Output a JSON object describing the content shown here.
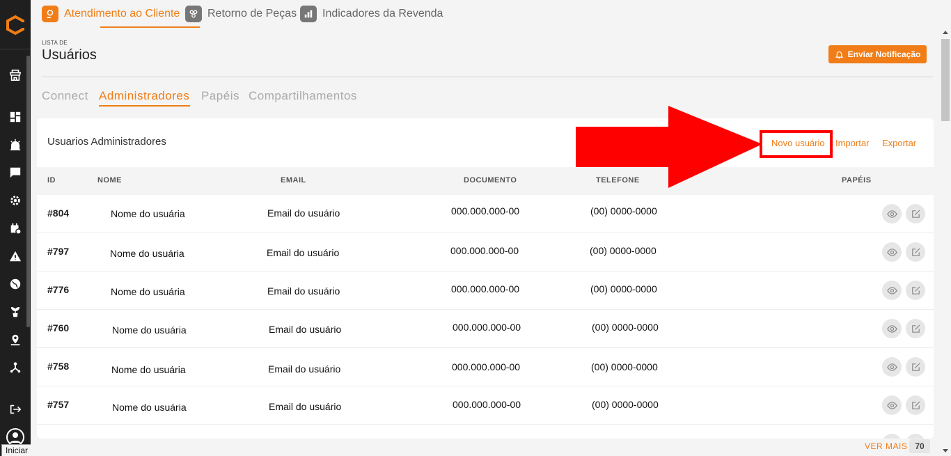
{
  "sidebar": {
    "icons": [
      "logo-icon",
      "store-icon",
      "dashboard-icon",
      "alarm-icon",
      "chat-icon",
      "settings-icon",
      "calendar-icon",
      "warning-icon",
      "globe-icon",
      "plant-icon",
      "location-icon",
      "hierarchy-icon",
      "logout-icon",
      "user-avatar-icon"
    ],
    "tooltip": "Iniciar"
  },
  "top_tabs": [
    {
      "label": "Atendimento ao Cliente",
      "icon": "customer-service-icon",
      "active": true
    },
    {
      "label": "Retorno de Peças",
      "icon": "parts-icon",
      "active": false
    },
    {
      "label": "Indicadores da Revenda",
      "icon": "chart-icon",
      "active": false
    }
  ],
  "header": {
    "subtitle": "LISTA DE",
    "title": "Usuários",
    "notify_button": "Enviar Notificação"
  },
  "sub_tabs": [
    {
      "label": "Connect",
      "active": false
    },
    {
      "label": "Administradores",
      "active": true
    },
    {
      "label": "Papéis",
      "active": false
    },
    {
      "label": "Compartilhamentos",
      "active": false
    }
  ],
  "card": {
    "title": "Usuarios Administradores",
    "actions": {
      "new_user": "Novo usuário",
      "import": "Importar",
      "export": "Exportar"
    }
  },
  "table": {
    "columns": {
      "id": "ID",
      "name": "NOME",
      "email": "EMAIL",
      "document": "DOCUMENTO",
      "phone": "TELEFONE",
      "roles": "PAPÉIS"
    },
    "rows": [
      {
        "id": "#804",
        "name": "Nome do usuária",
        "email": "Email do usuário",
        "document": "000.000.000-00",
        "phone": "(00) 0000-0000"
      },
      {
        "id": "#797",
        "name": "Nome do usuária",
        "email": "Email do usuário",
        "document": "000.000.000-00",
        "phone": "(00) 0000-0000"
      },
      {
        "id": "#776",
        "name": "Nome do usuária",
        "email": "Email do usuário",
        "document": "000.000.000-00",
        "phone": "(00) 0000-0000"
      },
      {
        "id": "#760",
        "name": "Nome do usuária",
        "email": "Email do usuário",
        "document": "000.000.000-00",
        "phone": "(00) 0000-0000"
      },
      {
        "id": "#758",
        "name": "Nome do usuária",
        "email": "Email do usuário",
        "document": "000.000.000-00",
        "phone": "(00) 0000-0000"
      },
      {
        "id": "#757",
        "name": "Nome do usuária",
        "email": "Email do usuário",
        "document": "000.000.000-00",
        "phone": "(00) 0000-0000"
      }
    ]
  },
  "footer": {
    "see_more": "VER MAIS",
    "count": "70"
  },
  "colors": {
    "accent": "#f07d17",
    "sidebar": "#1f1f1f",
    "annotation": "#ff0000"
  }
}
